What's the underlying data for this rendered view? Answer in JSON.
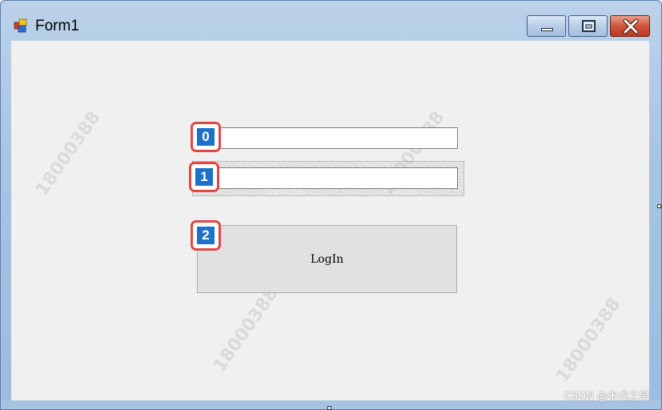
{
  "window": {
    "title": "Form1",
    "icon": "winforms-app-icon",
    "controls": {
      "minimize": "minimize-icon",
      "maximize": "maximize-icon",
      "close": "close-icon"
    }
  },
  "form": {
    "textbox0": {
      "value": "",
      "placeholder": ""
    },
    "textbox1": {
      "value": "",
      "placeholder": ""
    },
    "login_label": "LogIn"
  },
  "badges": [
    "0",
    "1",
    "2"
  ],
  "watermarks": [
    "18000388",
    "18000388",
    "18000388",
    "18000388"
  ],
  "credit": "CSDN @禾戊之昂",
  "colors": {
    "badge_border": "#e04848",
    "badge_fill": "#1d72c8",
    "client_bg": "#f0f0f0",
    "titlebar": "#a8c3e2",
    "close_button": "#c0391f"
  }
}
